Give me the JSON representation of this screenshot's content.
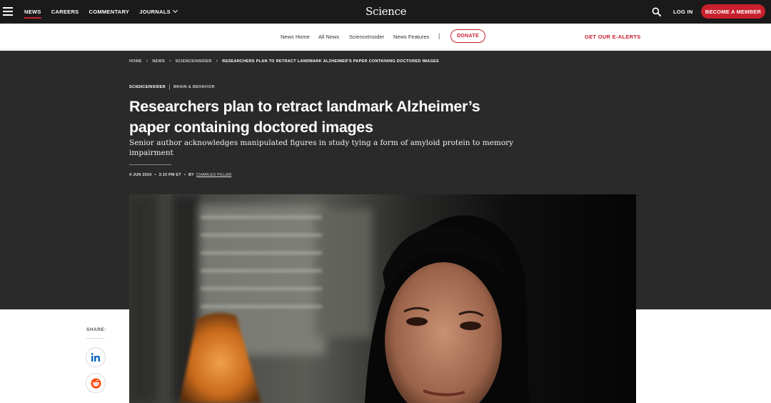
{
  "topbar": {
    "nav": [
      "NEWS",
      "CAREERS",
      "COMMENTARY",
      "JOURNALS"
    ],
    "logo": "Science",
    "login": "LOG IN",
    "member_button": "BECOME A MEMBER",
    "accent_color": "#c8202d"
  },
  "subnav": {
    "links": [
      "News Home",
      "All News",
      "ScienceInsider",
      "News Features"
    ],
    "separator": "|",
    "donate": "DONATE",
    "ealerts": "GET OUR E-ALERTS"
  },
  "breadcrumb": [
    "HOME",
    "NEWS",
    "SCIENCEINSIDER",
    "RESEARCHERS PLAN TO RETRACT LANDMARK ALZHEIMER'S PAPER CONTAINING DOCTORED IMAGES"
  ],
  "article": {
    "section": "SCIENCEINSIDER",
    "subsection": "BRAIN & BEHAVIOR",
    "headline": "Researchers plan to retract landmark Alzheimer’s paper containing doctored images",
    "dek": "Senior author acknowledges manipulated figures in study tying a form of amyloid protein to memory impairment",
    "date": "4 JUN 2024",
    "time": "3:10 PM ET",
    "by": "BY",
    "author": "CHARLES PILLER"
  },
  "share": {
    "label": "SHARE:",
    "buttons": [
      "linkedin-icon",
      "reddit-icon"
    ]
  }
}
